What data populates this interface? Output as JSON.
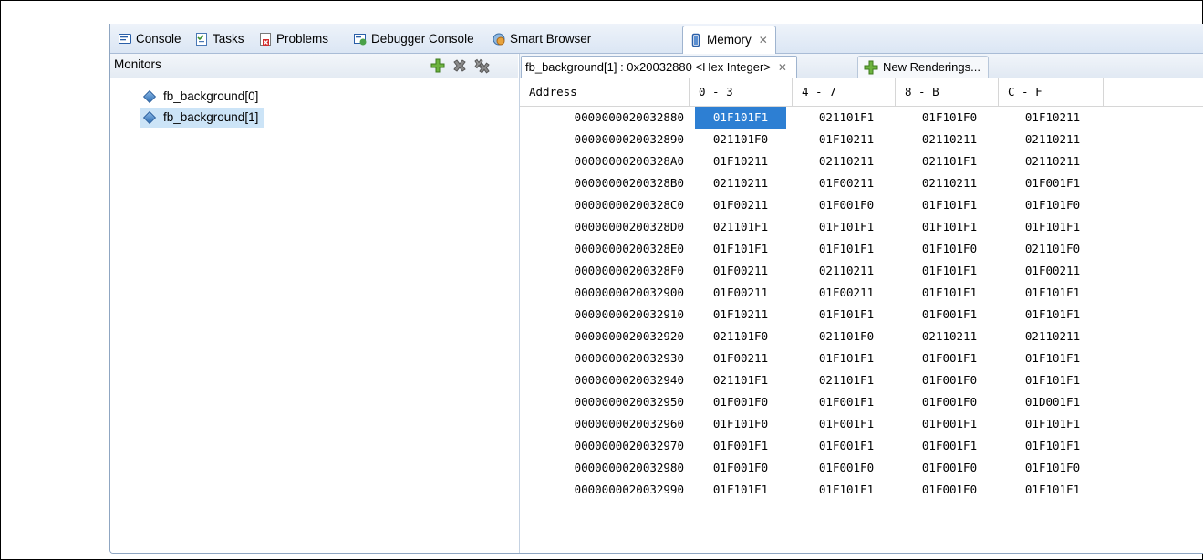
{
  "view_tabs": [
    {
      "label": "Console",
      "icon": "console-icon"
    },
    {
      "label": "Tasks",
      "icon": "tasks-icon"
    },
    {
      "label": "Problems",
      "icon": "problems-icon"
    },
    {
      "label": "Debugger Console",
      "icon": "debugger-console-icon"
    },
    {
      "label": "Smart Browser",
      "icon": "smart-browser-icon"
    },
    {
      "label": "Memory",
      "icon": "memory-icon",
      "active": true
    }
  ],
  "monitors": {
    "title": "Monitors",
    "items": [
      {
        "label": "fb_background[0]",
        "selected": false
      },
      {
        "label": "fb_background[1]",
        "selected": true
      }
    ]
  },
  "renderings": {
    "active_tab": "fb_background[1] : 0x20032880 <Hex Integer>",
    "new_tab": "New Renderings..."
  },
  "memory_table": {
    "headers": [
      "Address",
      "0 - 3",
      "4 - 7",
      "8 - B",
      "C - F"
    ],
    "rows": [
      [
        "0000000020032880",
        "01F101F1",
        "021101F1",
        "01F101F0",
        "01F10211"
      ],
      [
        "0000000020032890",
        "021101F0",
        "01F10211",
        "02110211",
        "02110211"
      ],
      [
        "00000000200328A0",
        "01F10211",
        "02110211",
        "021101F1",
        "02110211"
      ],
      [
        "00000000200328B0",
        "02110211",
        "01F00211",
        "02110211",
        "01F001F1"
      ],
      [
        "00000000200328C0",
        "01F00211",
        "01F001F0",
        "01F101F1",
        "01F101F0"
      ],
      [
        "00000000200328D0",
        "021101F1",
        "01F101F1",
        "01F101F1",
        "01F101F1"
      ],
      [
        "00000000200328E0",
        "01F101F1",
        "01F101F1",
        "01F101F0",
        "021101F0"
      ],
      [
        "00000000200328F0",
        "01F00211",
        "02110211",
        "01F101F1",
        "01F00211"
      ],
      [
        "0000000020032900",
        "01F00211",
        "01F00211",
        "01F101F1",
        "01F101F1"
      ],
      [
        "0000000020032910",
        "01F10211",
        "01F101F1",
        "01F001F1",
        "01F101F1"
      ],
      [
        "0000000020032920",
        "021101F0",
        "021101F0",
        "02110211",
        "02110211"
      ],
      [
        "0000000020032930",
        "01F00211",
        "01F101F1",
        "01F001F1",
        "01F101F1"
      ],
      [
        "0000000020032940",
        "021101F1",
        "021101F1",
        "01F001F0",
        "01F101F1"
      ],
      [
        "0000000020032950",
        "01F001F0",
        "01F001F1",
        "01F001F0",
        "01D001F1"
      ],
      [
        "0000000020032960",
        "01F101F0",
        "01F001F1",
        "01F001F1",
        "01F101F1"
      ],
      [
        "0000000020032970",
        "01F001F1",
        "01F001F1",
        "01F001F1",
        "01F101F1"
      ],
      [
        "0000000020032980",
        "01F001F0",
        "01F001F0",
        "01F001F0",
        "01F101F0"
      ],
      [
        "0000000020032990",
        "01F101F1",
        "01F101F1",
        "01F001F0",
        "01F101F1"
      ]
    ],
    "selected_cell_value": "01F101F1"
  },
  "colors": {
    "selection": "#2d7fd3",
    "tree_selection": "#cce4f7",
    "add_icon": "#5aa02c"
  }
}
